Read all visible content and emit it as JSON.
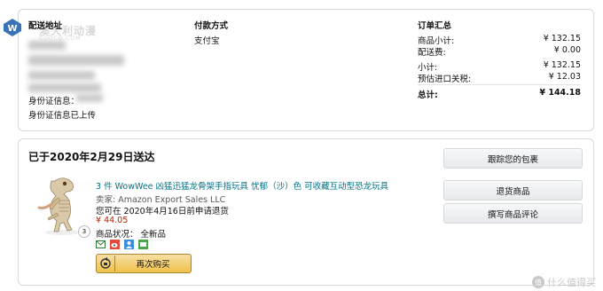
{
  "watermark": {
    "site_name": "澳大利动漫",
    "site_domain": "COOCO.COM"
  },
  "shipping": {
    "header": "配送地址",
    "id_label": "身份证信息：",
    "id_status": "身份证信息已上传"
  },
  "payment": {
    "header": "付款方式",
    "method": "支付宝"
  },
  "order_summary": {
    "header": "订单汇总",
    "rows": [
      {
        "label": "商品小计:",
        "value": "¥ 132.15"
      },
      {
        "label": "配送费:",
        "value": "¥ 0.00"
      },
      {
        "label": "小计:",
        "value": "¥ 132.15"
      },
      {
        "label": "预估进口关税:",
        "value": "¥ 12.03"
      }
    ],
    "total_label": "总计:",
    "total_value": "¥ 144.18"
  },
  "shipment": {
    "title": "已于2020年2月29日送达",
    "product": {
      "title": "3 件 WowWee 凶猛迅猛龙骨架手指玩具 忧郁（沙）色 可收藏互动型恐龙玩具",
      "seller": "卖家: Amazon Export Sales LLC",
      "return_note": "您可在 2020年4月16日前申请退货",
      "price": "¥ 44.05",
      "quantity": "3",
      "condition_label": "商品状况：",
      "condition_value": "全新品",
      "buy_again": "再次购买"
    },
    "buttons": {
      "track": "跟踪您的包裹",
      "return": "退货商品",
      "review": "撰写商品评论"
    }
  },
  "footer_watermark": {
    "text": "什么值得买",
    "badge": "值"
  }
}
